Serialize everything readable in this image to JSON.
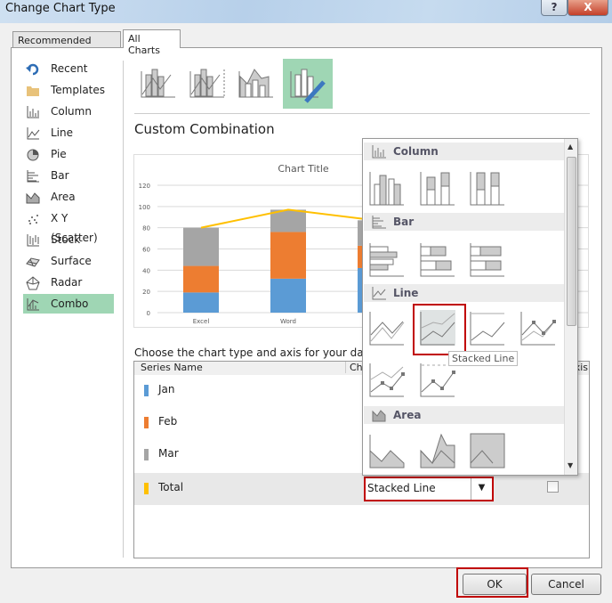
{
  "window": {
    "title": "Change Chart Type",
    "help": "?",
    "close": "X"
  },
  "tabs": [
    {
      "label": "Recommended Charts"
    },
    {
      "label": "All Charts",
      "selected": true
    }
  ],
  "sidebar": {
    "items": [
      {
        "label": "Recent",
        "icon": "recent-icon"
      },
      {
        "label": "Templates",
        "icon": "folder-icon"
      },
      {
        "label": "Column",
        "icon": "column-chart-icon"
      },
      {
        "label": "Line",
        "icon": "line-chart-icon"
      },
      {
        "label": "Pie",
        "icon": "pie-chart-icon"
      },
      {
        "label": "Bar",
        "icon": "bar-chart-icon"
      },
      {
        "label": "Area",
        "icon": "area-chart-icon"
      },
      {
        "label": "X Y (Scatter)",
        "icon": "scatter-chart-icon"
      },
      {
        "label": "Stock",
        "icon": "stock-chart-icon"
      },
      {
        "label": "Surface",
        "icon": "surface-chart-icon"
      },
      {
        "label": "Radar",
        "icon": "radar-chart-icon"
      },
      {
        "label": "Combo",
        "icon": "combo-chart-icon",
        "selected": true
      }
    ]
  },
  "main": {
    "section_title": "Custom Combination",
    "choose_label": "Choose the chart type and axis for your data series",
    "table": {
      "headers": [
        "Series Name",
        "Chart Type",
        "Secondary Axis"
      ],
      "rows": [
        {
          "name": "Jan",
          "color": "#5b9bd5"
        },
        {
          "name": "Feb",
          "color": "#ed7d31"
        },
        {
          "name": "Mar",
          "color": "#a5a5a5"
        },
        {
          "name": "Total",
          "color": "#ffc000",
          "chart_type": "Stacked Line",
          "secondary_axis": false,
          "selected": true
        }
      ]
    }
  },
  "chart_data": {
    "type": "bar",
    "stacked": true,
    "title": "Chart Title",
    "categories": [
      "Excel",
      "Word",
      ""
    ],
    "ylim": [
      0,
      120
    ],
    "yticks": [
      0,
      20,
      40,
      60,
      80,
      100,
      120
    ],
    "grid": true,
    "series": [
      {
        "name": "Jan",
        "type": "bar",
        "color": "#5b9bd5",
        "values": [
          19,
          32,
          42
        ]
      },
      {
        "name": "Feb",
        "type": "bar",
        "color": "#ed7d31",
        "values": [
          25,
          44,
          21
        ]
      },
      {
        "name": "Mar",
        "type": "bar",
        "color": "#a5a5a5",
        "values": [
          36,
          21,
          24
        ]
      },
      {
        "name": "Total",
        "type": "line",
        "color": "#ffc000",
        "values": [
          80,
          97,
          87
        ]
      }
    ]
  },
  "dropdown": {
    "sections": [
      {
        "label": "Column"
      },
      {
        "label": "Bar"
      },
      {
        "label": "Line"
      },
      {
        "label": "Area"
      }
    ],
    "tooltip": "Stacked Line",
    "hovered": "Stacked Line"
  },
  "buttons": {
    "ok": "OK",
    "cancel": "Cancel"
  }
}
